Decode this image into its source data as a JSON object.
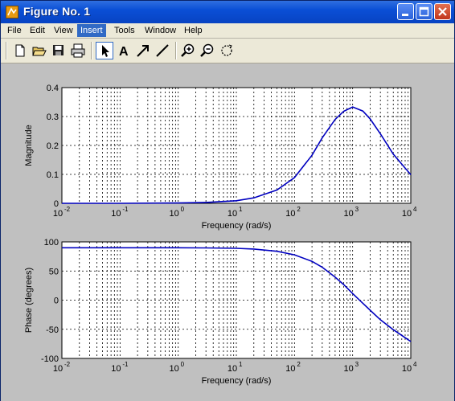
{
  "window": {
    "title": "Figure No. 1",
    "icon": "matlab-figure-icon"
  },
  "menubar": {
    "items": [
      {
        "label": "File"
      },
      {
        "label": "Edit"
      },
      {
        "label": "View"
      },
      {
        "label": "Insert",
        "active": true
      },
      {
        "label": "Tools"
      },
      {
        "label": "Window"
      },
      {
        "label": "Help"
      }
    ]
  },
  "toolbar": {
    "buttons": [
      "new-file-icon",
      "open-folder-icon",
      "save-icon",
      "print-icon",
      "select-arrow-icon",
      "text-icon",
      "arrow-tool-icon",
      "line-tool-icon",
      "zoom-in-icon",
      "zoom-out-icon",
      "rotate-icon"
    ]
  },
  "colors": {
    "curve": "#0000c0",
    "axes_bg": "#ffffff",
    "figure_bg": "#c0c0c0"
  },
  "chart_data": [
    {
      "type": "line",
      "xscale": "log",
      "xlim": [
        0.01,
        10000
      ],
      "ylim": [
        0,
        0.4
      ],
      "xlabel": "Frequency (rad/s)",
      "ylabel": "Magnitude",
      "grid": true,
      "x_tick_labels": [
        "10",
        "10",
        "10",
        "10",
        "10",
        "10",
        "10"
      ],
      "x_tick_exponents": [
        "-2",
        "-1",
        "0",
        "1",
        "2",
        "3",
        "4"
      ],
      "y_tick_labels": [
        "0",
        "0.1",
        "0.2",
        "0.3",
        "0.4"
      ],
      "y_ticks": [
        0,
        0.1,
        0.2,
        0.3,
        0.4
      ],
      "series": [
        {
          "x": [
            0.01,
            0.1,
            1,
            3,
            10,
            20,
            50,
            100,
            200,
            300,
            500,
            700,
            1000,
            1500,
            2000,
            3000,
            5000,
            10000
          ],
          "y": [
            0.0,
            0.0001,
            0.001,
            0.003,
            0.009,
            0.019,
            0.046,
            0.089,
            0.166,
            0.226,
            0.29,
            0.318,
            0.333,
            0.319,
            0.292,
            0.24,
            0.17,
            0.099
          ]
        }
      ]
    },
    {
      "type": "line",
      "xscale": "log",
      "xlim": [
        0.01,
        10000
      ],
      "ylim": [
        -100,
        100
      ],
      "xlabel": "Frequency (rad/s)",
      "ylabel": "Phase (degrees)",
      "grid": true,
      "x_tick_labels": [
        "10",
        "10",
        "10",
        "10",
        "10",
        "10",
        "10"
      ],
      "x_tick_exponents": [
        "-2",
        "-1",
        "0",
        "1",
        "2",
        "3",
        "4"
      ],
      "y_tick_labels": [
        "100",
        "50",
        "0",
        "-50",
        "-100"
      ],
      "y_ticks": [
        100,
        50,
        0,
        -50,
        -100
      ],
      "series": [
        {
          "x": [
            0.01,
            0.1,
            1,
            3,
            10,
            20,
            50,
            100,
            200,
            300,
            500,
            700,
            1000,
            1500,
            2000,
            3000,
            5000,
            10000
          ],
          "y": [
            90,
            90,
            89.9,
            89.7,
            88.9,
            87.7,
            83.9,
            77.8,
            66.6,
            56.5,
            39.4,
            26.8,
            11.3,
            -5.4,
            -17.3,
            -33.6,
            -50.6,
            -71.1
          ]
        }
      ]
    }
  ]
}
